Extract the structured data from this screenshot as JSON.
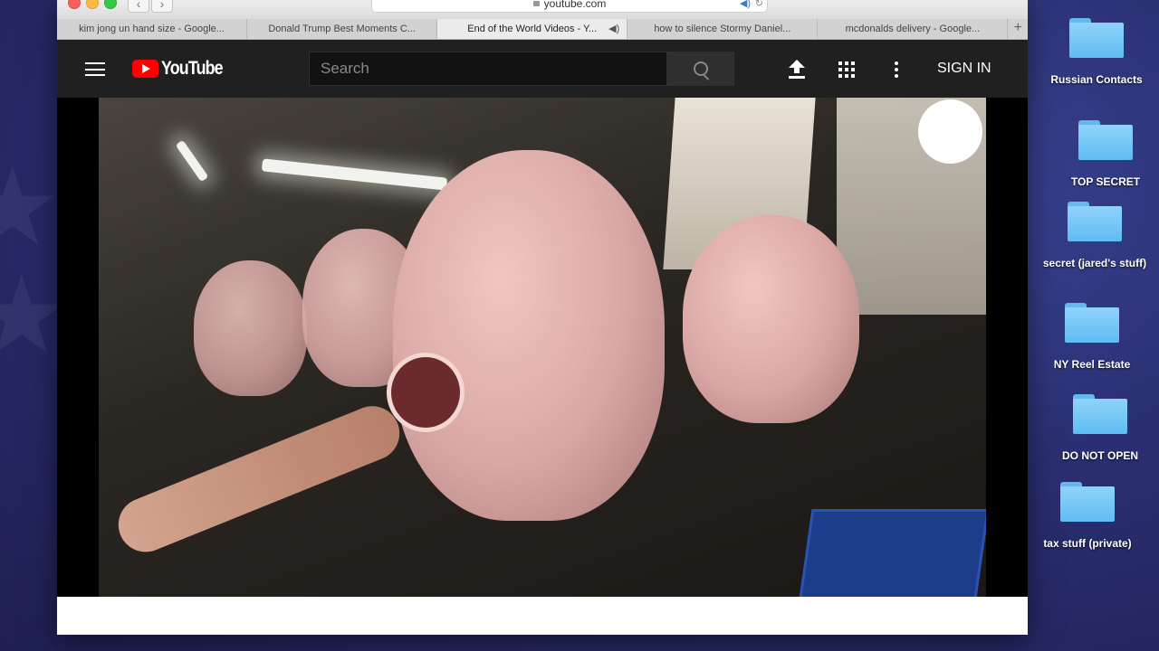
{
  "browser": {
    "url": "youtube.com",
    "tabs": [
      {
        "title": "kim jong un hand size - Google...",
        "active": false,
        "audio": false
      },
      {
        "title": "Donald Trump Best Moments C...",
        "active": false,
        "audio": false
      },
      {
        "title": "End of the World Videos - Y...",
        "active": true,
        "audio": true
      },
      {
        "title": "how to silence Stormy Daniel...",
        "active": false,
        "audio": false
      },
      {
        "title": "mcdonalds delivery - Google...",
        "active": false,
        "audio": false
      }
    ]
  },
  "youtube": {
    "logo_text": "YouTube",
    "search_placeholder": "Search",
    "signin_label": "SIGN IN"
  },
  "desktop": {
    "items": [
      {
        "label": "Russian Contacts"
      },
      {
        "label": "TOP SECRET"
      },
      {
        "label": "secret (jared's stuff)"
      },
      {
        "label": "NY Reel Estate"
      },
      {
        "label": "DO NOT OPEN"
      },
      {
        "label": "tax stuff (private)"
      }
    ]
  },
  "colors": {
    "youtube_red": "#ff0000",
    "header_bg": "#202020",
    "folder_blue": "#6cc4f6"
  }
}
